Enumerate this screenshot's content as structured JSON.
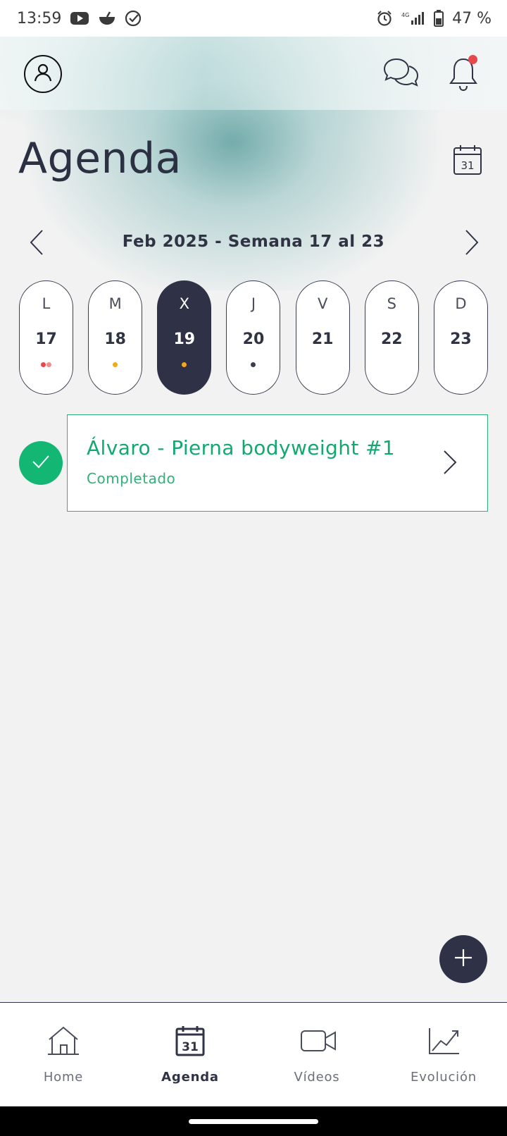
{
  "status_bar": {
    "time": "13:59",
    "network": "4G",
    "battery": "47 %",
    "icons": [
      "youtube-icon",
      "app-bowl-icon",
      "check-circle-icon",
      "alarm-icon",
      "signal-icon",
      "battery-icon"
    ]
  },
  "header": {
    "title": "Agenda",
    "notification_badge_color": "#e8474d",
    "calendar_icon_day": "31"
  },
  "week_nav": {
    "label": "Feb 2025 - Semana 17 al 23"
  },
  "days": [
    {
      "letter": "L",
      "number": "17",
      "selected": false,
      "dots": [
        "#e8474d",
        "#f08c8c"
      ]
    },
    {
      "letter": "M",
      "number": "18",
      "selected": false,
      "dots": [
        "#f0a81e"
      ]
    },
    {
      "letter": "X",
      "number": "19",
      "selected": true,
      "dots": [
        "#f0a81e"
      ]
    },
    {
      "letter": "J",
      "number": "20",
      "selected": false,
      "dots": [
        "#3a3d4e"
      ]
    },
    {
      "letter": "V",
      "number": "21",
      "selected": false,
      "dots": []
    },
    {
      "letter": "S",
      "number": "22",
      "selected": false,
      "dots": []
    },
    {
      "letter": "D",
      "number": "23",
      "selected": false,
      "dots": []
    }
  ],
  "workout": {
    "title": "Álvaro - Pierna bodyweight #1",
    "status": "Completado",
    "accent": "#13b673"
  },
  "tabs": [
    {
      "label": "Home",
      "icon": "home-icon",
      "active": false
    },
    {
      "label": "Agenda",
      "icon": "calendar-icon",
      "active": true,
      "icon_day": "31"
    },
    {
      "label": "Vídeos",
      "icon": "video-icon",
      "active": false
    },
    {
      "label": "Evolución",
      "icon": "chart-icon",
      "active": false
    }
  ],
  "colors": {
    "primary_dark": "#2f3247",
    "success": "#13b673",
    "background": "#f2f2f2"
  }
}
